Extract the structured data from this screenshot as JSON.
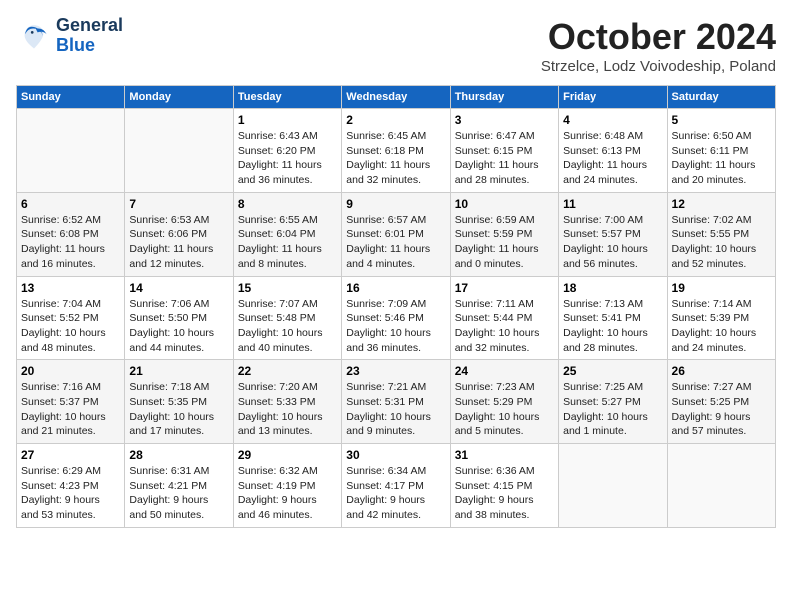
{
  "header": {
    "logo_general": "General",
    "logo_blue": "Blue",
    "month": "October 2024",
    "location": "Strzelce, Lodz Voivodeship, Poland"
  },
  "weekdays": [
    "Sunday",
    "Monday",
    "Tuesday",
    "Wednesday",
    "Thursday",
    "Friday",
    "Saturday"
  ],
  "weeks": [
    [
      {
        "day": "",
        "info": ""
      },
      {
        "day": "",
        "info": ""
      },
      {
        "day": "1",
        "info": "Sunrise: 6:43 AM\nSunset: 6:20 PM\nDaylight: 11 hours\nand 36 minutes."
      },
      {
        "day": "2",
        "info": "Sunrise: 6:45 AM\nSunset: 6:18 PM\nDaylight: 11 hours\nand 32 minutes."
      },
      {
        "day": "3",
        "info": "Sunrise: 6:47 AM\nSunset: 6:15 PM\nDaylight: 11 hours\nand 28 minutes."
      },
      {
        "day": "4",
        "info": "Sunrise: 6:48 AM\nSunset: 6:13 PM\nDaylight: 11 hours\nand 24 minutes."
      },
      {
        "day": "5",
        "info": "Sunrise: 6:50 AM\nSunset: 6:11 PM\nDaylight: 11 hours\nand 20 minutes."
      }
    ],
    [
      {
        "day": "6",
        "info": "Sunrise: 6:52 AM\nSunset: 6:08 PM\nDaylight: 11 hours\nand 16 minutes."
      },
      {
        "day": "7",
        "info": "Sunrise: 6:53 AM\nSunset: 6:06 PM\nDaylight: 11 hours\nand 12 minutes."
      },
      {
        "day": "8",
        "info": "Sunrise: 6:55 AM\nSunset: 6:04 PM\nDaylight: 11 hours\nand 8 minutes."
      },
      {
        "day": "9",
        "info": "Sunrise: 6:57 AM\nSunset: 6:01 PM\nDaylight: 11 hours\nand 4 minutes."
      },
      {
        "day": "10",
        "info": "Sunrise: 6:59 AM\nSunset: 5:59 PM\nDaylight: 11 hours\nand 0 minutes."
      },
      {
        "day": "11",
        "info": "Sunrise: 7:00 AM\nSunset: 5:57 PM\nDaylight: 10 hours\nand 56 minutes."
      },
      {
        "day": "12",
        "info": "Sunrise: 7:02 AM\nSunset: 5:55 PM\nDaylight: 10 hours\nand 52 minutes."
      }
    ],
    [
      {
        "day": "13",
        "info": "Sunrise: 7:04 AM\nSunset: 5:52 PM\nDaylight: 10 hours\nand 48 minutes."
      },
      {
        "day": "14",
        "info": "Sunrise: 7:06 AM\nSunset: 5:50 PM\nDaylight: 10 hours\nand 44 minutes."
      },
      {
        "day": "15",
        "info": "Sunrise: 7:07 AM\nSunset: 5:48 PM\nDaylight: 10 hours\nand 40 minutes."
      },
      {
        "day": "16",
        "info": "Sunrise: 7:09 AM\nSunset: 5:46 PM\nDaylight: 10 hours\nand 36 minutes."
      },
      {
        "day": "17",
        "info": "Sunrise: 7:11 AM\nSunset: 5:44 PM\nDaylight: 10 hours\nand 32 minutes."
      },
      {
        "day": "18",
        "info": "Sunrise: 7:13 AM\nSunset: 5:41 PM\nDaylight: 10 hours\nand 28 minutes."
      },
      {
        "day": "19",
        "info": "Sunrise: 7:14 AM\nSunset: 5:39 PM\nDaylight: 10 hours\nand 24 minutes."
      }
    ],
    [
      {
        "day": "20",
        "info": "Sunrise: 7:16 AM\nSunset: 5:37 PM\nDaylight: 10 hours\nand 21 minutes."
      },
      {
        "day": "21",
        "info": "Sunrise: 7:18 AM\nSunset: 5:35 PM\nDaylight: 10 hours\nand 17 minutes."
      },
      {
        "day": "22",
        "info": "Sunrise: 7:20 AM\nSunset: 5:33 PM\nDaylight: 10 hours\nand 13 minutes."
      },
      {
        "day": "23",
        "info": "Sunrise: 7:21 AM\nSunset: 5:31 PM\nDaylight: 10 hours\nand 9 minutes."
      },
      {
        "day": "24",
        "info": "Sunrise: 7:23 AM\nSunset: 5:29 PM\nDaylight: 10 hours\nand 5 minutes."
      },
      {
        "day": "25",
        "info": "Sunrise: 7:25 AM\nSunset: 5:27 PM\nDaylight: 10 hours\nand 1 minute."
      },
      {
        "day": "26",
        "info": "Sunrise: 7:27 AM\nSunset: 5:25 PM\nDaylight: 9 hours\nand 57 minutes."
      }
    ],
    [
      {
        "day": "27",
        "info": "Sunrise: 6:29 AM\nSunset: 4:23 PM\nDaylight: 9 hours\nand 53 minutes."
      },
      {
        "day": "28",
        "info": "Sunrise: 6:31 AM\nSunset: 4:21 PM\nDaylight: 9 hours\nand 50 minutes."
      },
      {
        "day": "29",
        "info": "Sunrise: 6:32 AM\nSunset: 4:19 PM\nDaylight: 9 hours\nand 46 minutes."
      },
      {
        "day": "30",
        "info": "Sunrise: 6:34 AM\nSunset: 4:17 PM\nDaylight: 9 hours\nand 42 minutes."
      },
      {
        "day": "31",
        "info": "Sunrise: 6:36 AM\nSunset: 4:15 PM\nDaylight: 9 hours\nand 38 minutes."
      },
      {
        "day": "",
        "info": ""
      },
      {
        "day": "",
        "info": ""
      }
    ]
  ]
}
